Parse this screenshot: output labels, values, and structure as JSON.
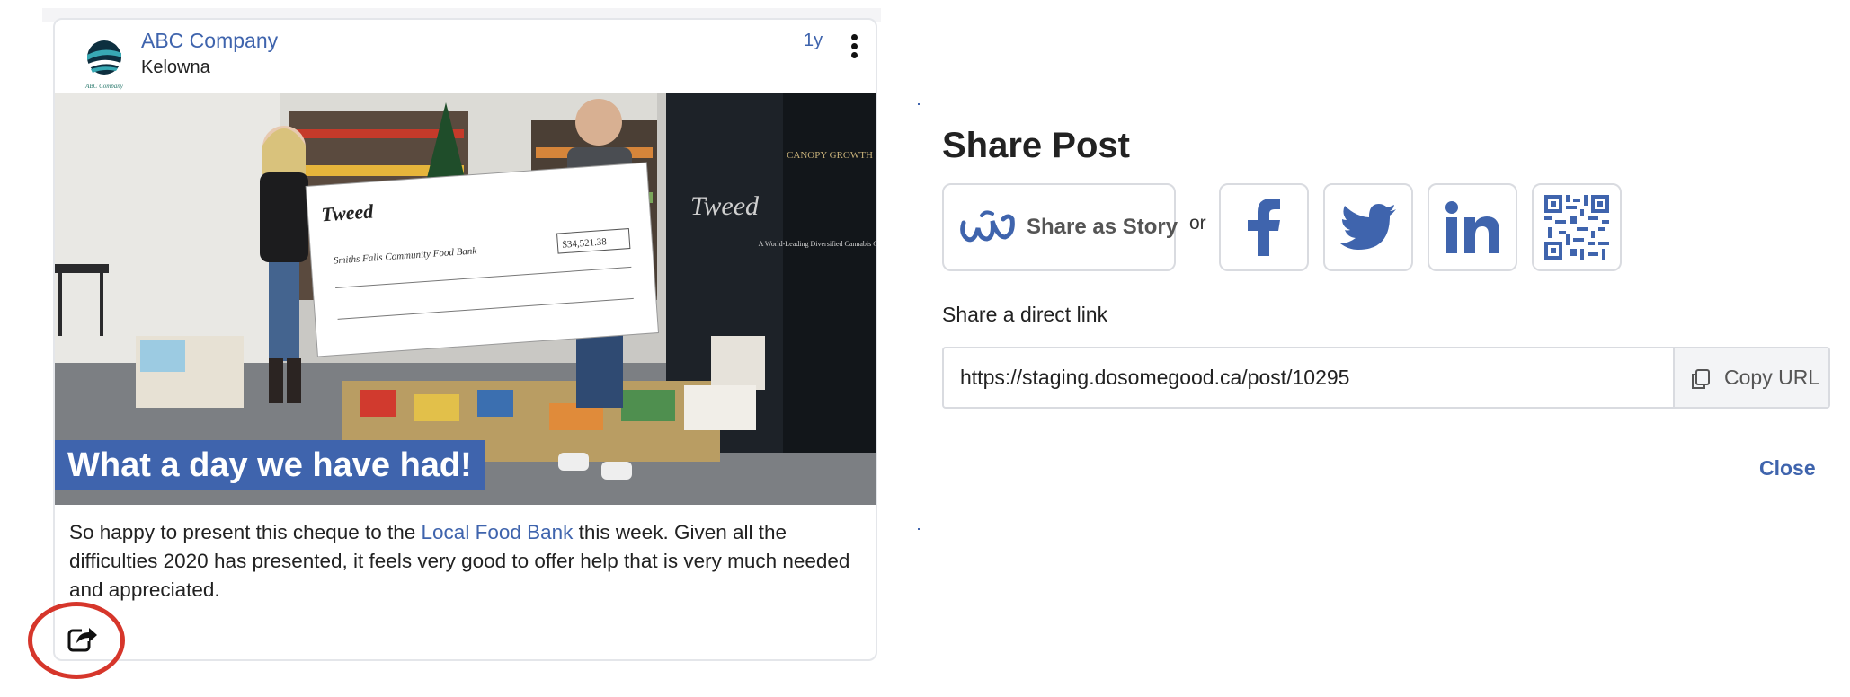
{
  "post": {
    "company_name": "ABC Company",
    "location": "Kelowna",
    "age": "1y",
    "image_caption": "What a day we have had!",
    "body_before_link": "So happy to present this cheque to the ",
    "body_link": "Local Food Bank",
    "body_after_link": " this week. Given all the difficulties 2020 has presented, it feels very good to offer help that is very much needed and appreciated.",
    "logo_text": "ABC Company"
  },
  "photo_signage": {
    "cheque_brand": "Tweed",
    "cheque_payee": "Smiths Falls Community Food Bank",
    "cheque_amount": "$34,521.38",
    "banner_brand": "Tweed",
    "banner_right_title": "CANOPY GROWTH",
    "banner_right_tagline": "A World-Leading Diversified Cannabis Company"
  },
  "share_panel": {
    "title": "Share Post",
    "story_label": "Share as Story",
    "or_text": "or",
    "direct_link_label": "Share a direct link",
    "url_value": "https://staging.dosomegood.ca/post/10295",
    "copy_label": "Copy URL",
    "close_label": "Close"
  },
  "colors": {
    "brand_blue": "#3f64ad",
    "highlight_ring": "#d6362b"
  },
  "icons": [
    "kebab-menu-icon",
    "share-icon",
    "story-icon",
    "facebook-icon",
    "twitter-icon",
    "linkedin-icon",
    "qr-code-icon",
    "copy-icon"
  ]
}
